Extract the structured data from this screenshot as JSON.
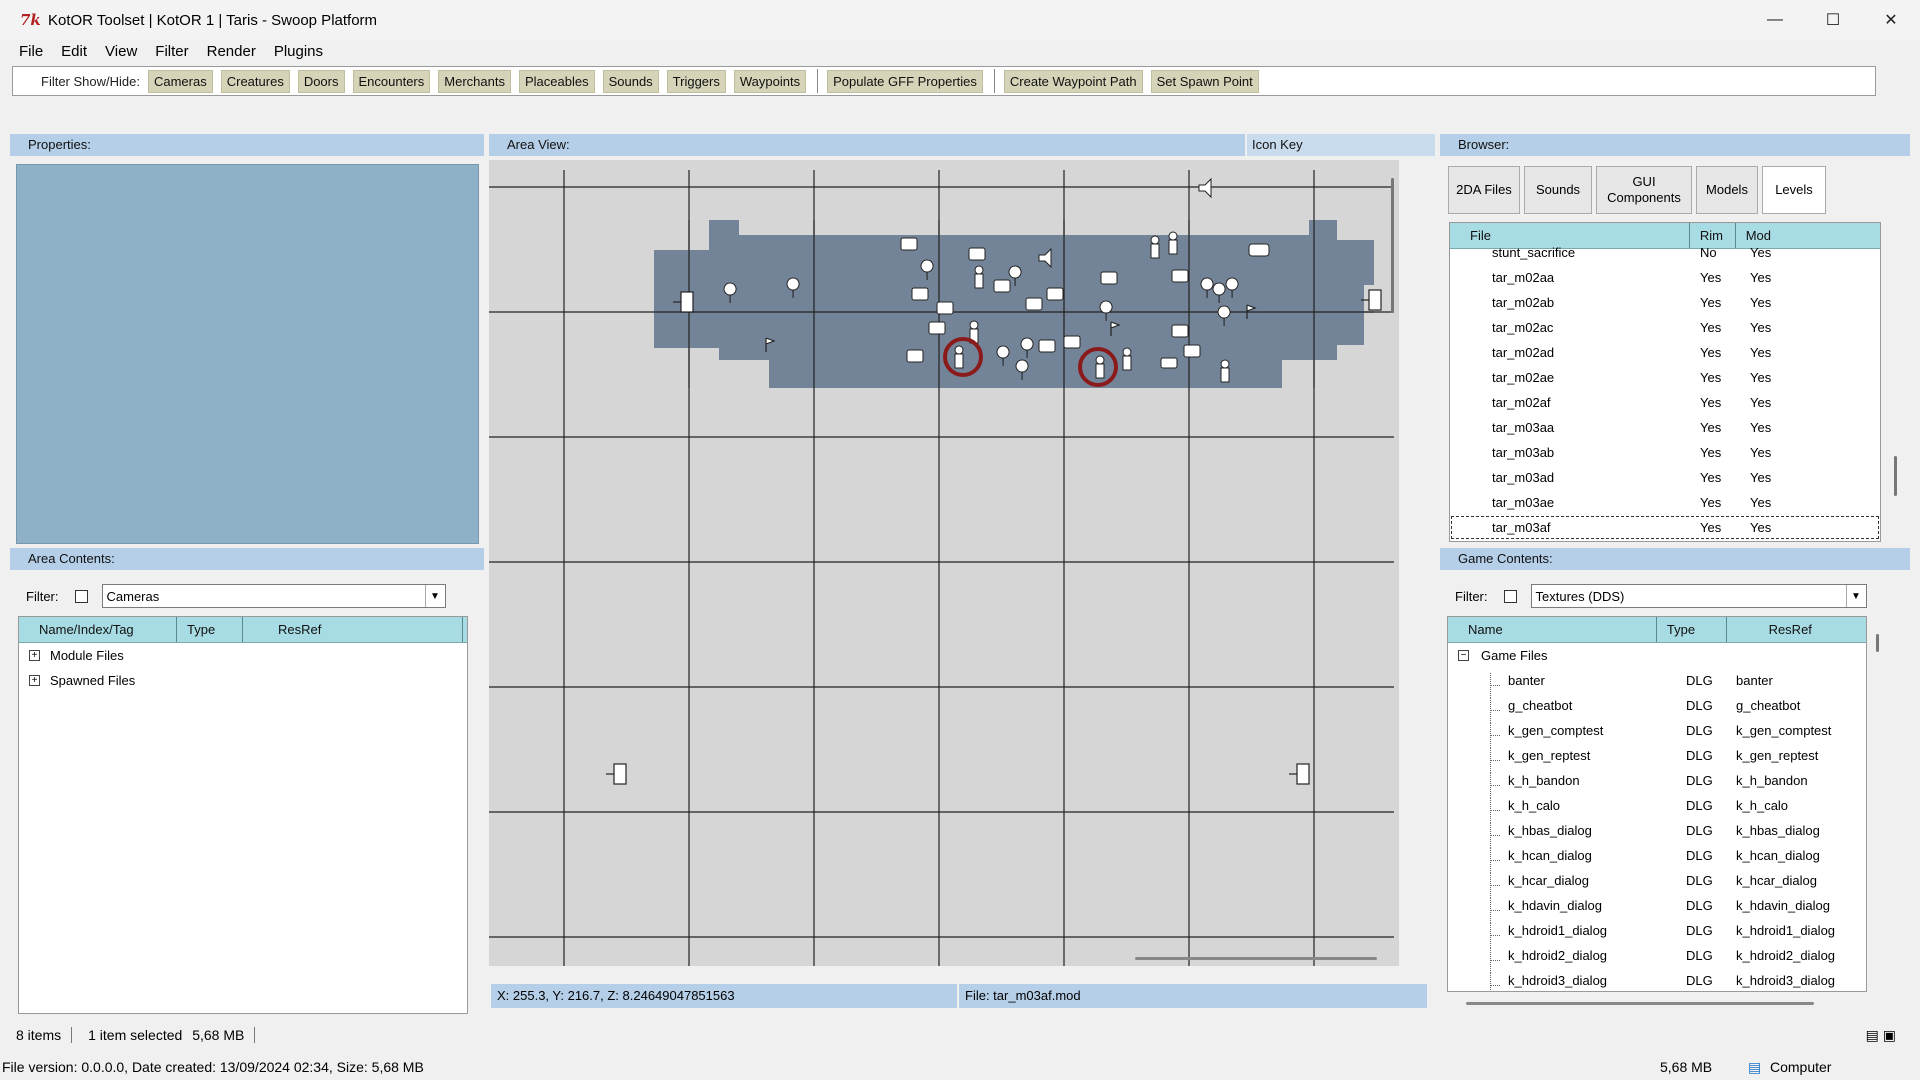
{
  "window": {
    "title": "KotOR Toolset | KotOR 1 | Taris - Swoop Platform",
    "app_icon": "7k"
  },
  "menu": [
    "File",
    "Edit",
    "View",
    "Filter",
    "Render",
    "Plugins"
  ],
  "toolbar": {
    "filter_label": "Filter Show/Hide:",
    "filters": [
      "Cameras",
      "Creatures",
      "Doors",
      "Encounters",
      "Merchants",
      "Placeables",
      "Sounds",
      "Triggers",
      "Waypoints"
    ],
    "populate": "Populate GFF Properties",
    "create_path": "Create Waypoint Path",
    "set_spawn": "Set Spawn Point"
  },
  "properties": {
    "header": "Properties:"
  },
  "area_contents": {
    "header": "Area Contents:",
    "filter_label": "Filter:",
    "filter_value": "Cameras",
    "columns": [
      "Name/Index/Tag",
      "Type",
      "ResRef"
    ],
    "items": [
      "Module Files",
      "Spawned Files"
    ]
  },
  "area_view": {
    "header": "Area View:",
    "icon_key": "Icon Key",
    "coords": "X: 255.3, Y: 216.7, Z: 8.24649047851563",
    "file": "File: tar_m03af.mod"
  },
  "browser": {
    "header": "Browser:",
    "tabs": [
      "2DA Files",
      "Sounds",
      "GUI Components",
      "Models",
      "Levels"
    ],
    "active_tab": "Levels",
    "columns": [
      "File",
      "Rim",
      "Mod"
    ],
    "rows": [
      [
        "stunt_sacrifice",
        "No",
        "Yes"
      ],
      [
        "tar_m02aa",
        "Yes",
        "Yes"
      ],
      [
        "tar_m02ab",
        "Yes",
        "Yes"
      ],
      [
        "tar_m02ac",
        "Yes",
        "Yes"
      ],
      [
        "tar_m02ad",
        "Yes",
        "Yes"
      ],
      [
        "tar_m02ae",
        "Yes",
        "Yes"
      ],
      [
        "tar_m02af",
        "Yes",
        "Yes"
      ],
      [
        "tar_m03aa",
        "Yes",
        "Yes"
      ],
      [
        "tar_m03ab",
        "Yes",
        "Yes"
      ],
      [
        "tar_m03ad",
        "Yes",
        "Yes"
      ],
      [
        "tar_m03ae",
        "Yes",
        "Yes"
      ],
      [
        "tar_m03af",
        "Yes",
        "Yes"
      ]
    ]
  },
  "game_contents": {
    "header": "Game Contents:",
    "filter_label": "Filter:",
    "filter_value": "Textures (DDS)",
    "columns": [
      "Name",
      "Type",
      "ResRef"
    ],
    "root": "Game Files",
    "rows": [
      [
        "banter",
        "DLG",
        "banter"
      ],
      [
        "g_cheatbot",
        "DLG",
        "g_cheatbot"
      ],
      [
        "k_gen_comptest",
        "DLG",
        "k_gen_comptest"
      ],
      [
        "k_gen_reptest",
        "DLG",
        "k_gen_reptest"
      ],
      [
        "k_h_bandon",
        "DLG",
        "k_h_bandon"
      ],
      [
        "k_h_calo",
        "DLG",
        "k_h_calo"
      ],
      [
        "k_hbas_dialog",
        "DLG",
        "k_hbas_dialog"
      ],
      [
        "k_hcan_dialog",
        "DLG",
        "k_hcan_dialog"
      ],
      [
        "k_hcar_dialog",
        "DLG",
        "k_hcar_dialog"
      ],
      [
        "k_hdavin_dialog",
        "DLG",
        "k_hdavin_dialog"
      ],
      [
        "k_hdroid1_dialog",
        "DLG",
        "k_hdroid1_dialog"
      ],
      [
        "k_hdroid2_dialog",
        "DLG",
        "k_hdroid2_dialog"
      ],
      [
        "k_hdroid3_dialog",
        "DLG",
        "k_hdroid3_dialog"
      ]
    ]
  },
  "status": {
    "items": "8 items",
    "selected": "1 item selected",
    "size": "5,68 MB",
    "file_info": "File version: 0.0.0.0, Date created: 13/09/2024 02:34, Size: 5,68 MB",
    "size_right": "5,68 MB",
    "computer": "Computer"
  }
}
